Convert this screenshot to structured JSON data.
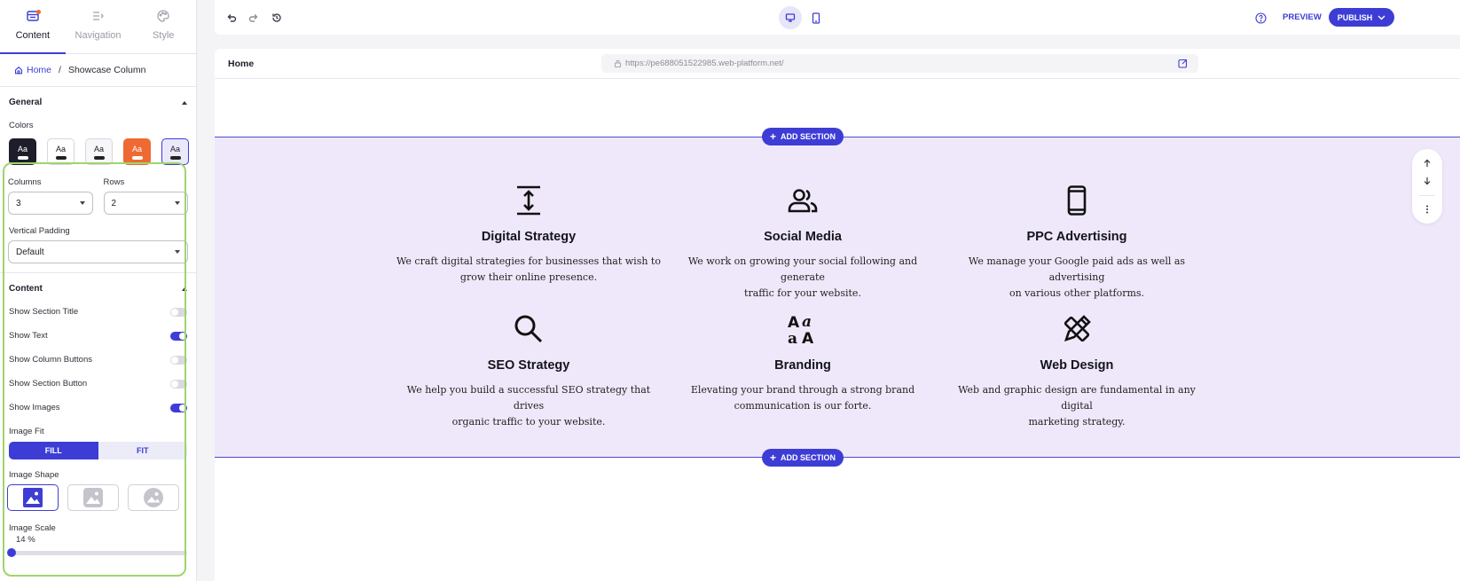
{
  "panel": {
    "tabs": [
      {
        "label": "Content",
        "icon": "content-layout-icon",
        "active": true
      },
      {
        "label": "Navigation",
        "icon": "navigation-icon",
        "active": false
      },
      {
        "label": "Style",
        "icon": "palette-icon",
        "active": false
      }
    ],
    "breadcrumb": {
      "home": "Home",
      "separator": "/",
      "current": "Showcase Column"
    },
    "general": {
      "title": "General",
      "colors_label": "Colors",
      "swatch_text": "Aa",
      "swatches": [
        "dark",
        "light",
        "grey",
        "orange",
        "lavender"
      ],
      "selected_swatch": "lavender",
      "columns_label": "Columns",
      "columns_value": "3",
      "rows_label": "Rows",
      "rows_value": "2",
      "vpad_label": "Vertical Padding",
      "vpad_value": "Default"
    },
    "content": {
      "title": "Content",
      "toggles": [
        {
          "label": "Show Section Title",
          "on": false
        },
        {
          "label": "Show Text",
          "on": true
        },
        {
          "label": "Show Column Buttons",
          "on": false
        },
        {
          "label": "Show Section Button",
          "on": false
        },
        {
          "label": "Show Images",
          "on": true
        }
      ],
      "image_fit_label": "Image Fit",
      "fit_options": [
        "FILL",
        "FIT"
      ],
      "fit_selected": "FILL",
      "image_shape_label": "Image Shape",
      "image_scale_label": "Image Scale",
      "image_scale_value": "14 %",
      "image_scale_fraction": 0.0
    }
  },
  "topbar": {
    "preview_label": "PREVIEW",
    "publish_label": "PUBLISH"
  },
  "browser": {
    "page_name": "Home",
    "url": "https://pe688051522985.web-platform.net/",
    "add_section_label": "ADD SECTION"
  },
  "colors": {
    "accent": "#3d3dd6",
    "section_bg": "#efe8fa",
    "highlight": "#9ed56e",
    "orange": "#ee6a32"
  },
  "columns": [
    {
      "icon": "vertical-resize-icon",
      "title": "Digital Strategy",
      "text": [
        "We craft digital strategies for businesses that wish to",
        "grow their online presence."
      ]
    },
    {
      "icon": "users-icon",
      "title": "Social Media",
      "text": [
        "We work on growing your social following and generate",
        "traffic for your website."
      ]
    },
    {
      "icon": "smartphone-icon",
      "title": "PPC Advertising",
      "text": [
        "We manage your Google paid ads as well as advertising",
        "on various other platforms."
      ]
    },
    {
      "icon": "search-icon",
      "title": "SEO Strategy",
      "text": [
        "We help you build a successful SEO strategy that drives",
        "organic traffic to your website."
      ]
    },
    {
      "icon": "font-icon",
      "title": "Branding",
      "text": [
        "Elevating your brand through a strong brand",
        "communication is our forte."
      ]
    },
    {
      "icon": "design-tools-icon",
      "title": "Web Design",
      "text": [
        "Web and graphic design are fundamental in any digital",
        "marketing strategy."
      ]
    }
  ]
}
